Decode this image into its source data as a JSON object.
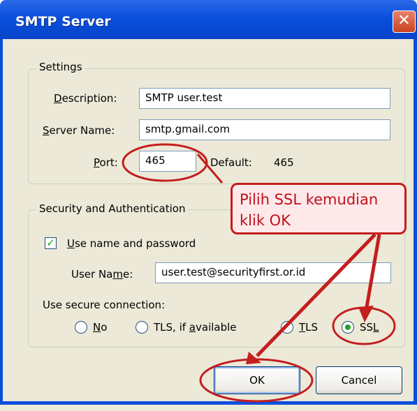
{
  "window": {
    "title": "SMTP Server",
    "close_glyph": "✕"
  },
  "settings": {
    "group_label": "Settings",
    "description_label": "Description:",
    "description_ak": "D",
    "description_rest": "escription:",
    "description_value": "SMTP user.test",
    "server_label_ak": "S",
    "server_label_rest": "erver Name:",
    "server_value": "smtp.gmail.com",
    "port_label_ak": "P",
    "port_label_rest": "ort:",
    "port_value": "465",
    "default_label": "Default:",
    "default_value": "465"
  },
  "security": {
    "group_label": "Security and Authentication",
    "use_name_ak": "U",
    "use_name_rest": "se name and password",
    "use_name_checked": true,
    "username_label_pre": "User Na",
    "username_label_ak": "m",
    "username_label_post": "e:",
    "username_value": "user.test@securityfirst.or.id",
    "secure_label": "Use secure connection:",
    "options": [
      {
        "pre": "",
        "ak": "N",
        "post": "o",
        "selected": false
      },
      {
        "pre": "TLS, if ",
        "ak": "a",
        "post": "vailable",
        "selected": false
      },
      {
        "pre": "",
        "ak": "T",
        "post": "LS",
        "selected": false
      },
      {
        "pre": "SS",
        "ak": "L",
        "post": "",
        "selected": true
      }
    ]
  },
  "buttons": {
    "ok": "OK",
    "cancel": "Cancel"
  },
  "annotation": {
    "line1": "Pilih SSL kemudian",
    "line2": "klik OK",
    "color": "#c41e1e"
  },
  "colors": {
    "titlebar": "#0a4fdc",
    "dialog_bg": "#ece9d8",
    "highlight": "#c41e1e"
  }
}
